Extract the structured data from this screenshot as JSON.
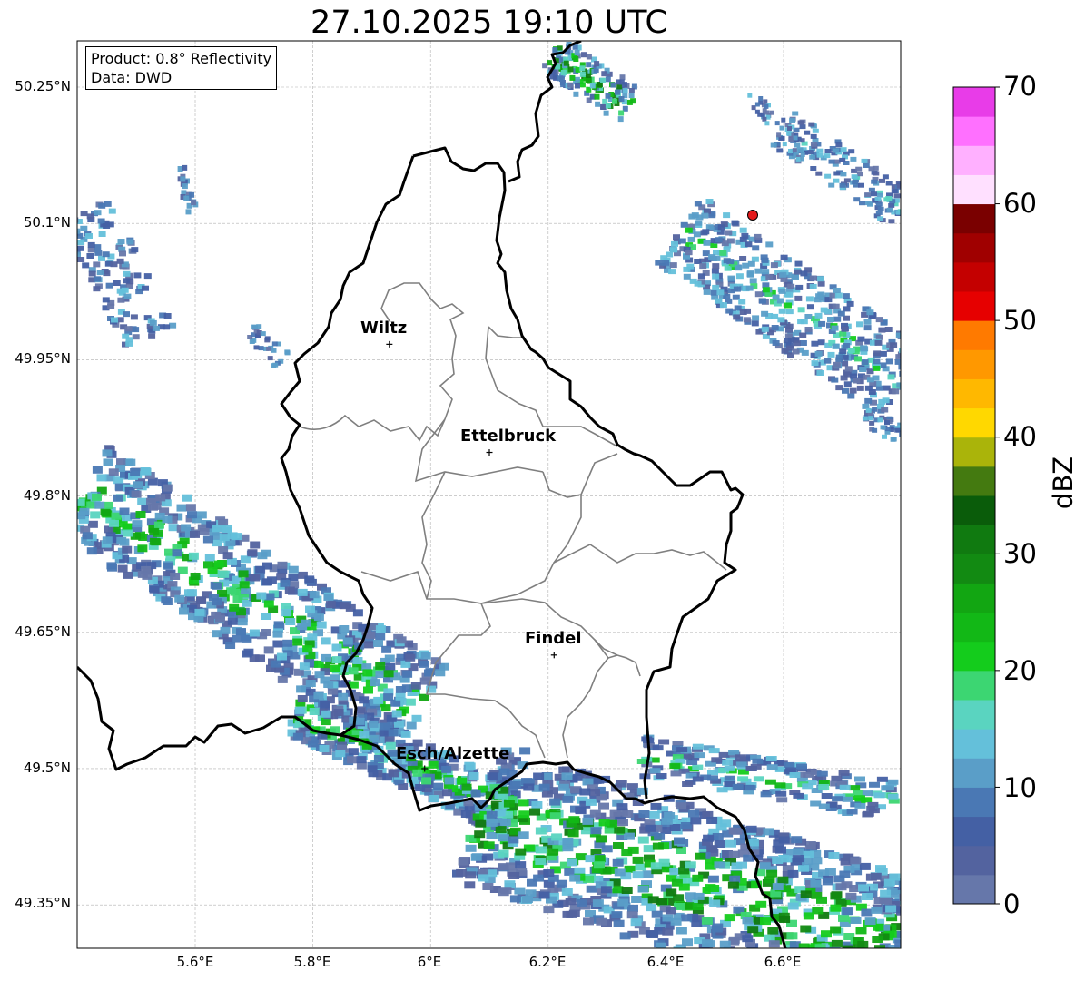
{
  "title": "27.10.2025 19:10 UTC",
  "info": {
    "product": "Product: 0.8° Reflectivity",
    "data": "Data: DWD"
  },
  "lon_labels": [
    "5.6°E",
    "5.8°E",
    "6°E",
    "6.2°E",
    "6.4°E",
    "6.6°E"
  ],
  "lat_labels": [
    "50.25°N",
    "50.1°N",
    "49.95°N",
    "49.8°N",
    "49.65°N",
    "49.5°N",
    "49.35°N"
  ],
  "cities": [
    {
      "name": "Wiltz",
      "lon": 5.93,
      "lat": 49.967
    },
    {
      "name": "Ettelbruck",
      "lon": 6.1,
      "lat": 49.848
    },
    {
      "name": "Findel",
      "lon": 6.21,
      "lat": 49.625
    },
    {
      "name": "Esch/Alzette",
      "lon": 5.99,
      "lat": 49.5
    }
  ],
  "radar_site_color": "#e31a1c",
  "colorbar": {
    "label": "dBZ",
    "ticks": [
      "0",
      "10",
      "20",
      "30",
      "40",
      "50",
      "60",
      "70"
    ],
    "min": 0,
    "max": 70,
    "colors": [
      "#6677aa",
      "#53639f",
      "#4460a4",
      "#4a78b4",
      "#5a9ec8",
      "#64c0da",
      "#5ad4c0",
      "#3cd672",
      "#14cc1c",
      "#12b816",
      "#12a612",
      "#128a12",
      "#107a10",
      "#0a5c0a",
      "#447a10",
      "#aab40a",
      "#ffd800",
      "#ffb800",
      "#ff9800",
      "#ff7a00",
      "#e60000",
      "#c40000",
      "#a00000",
      "#7a0000",
      "#ffe0ff",
      "#ffb0ff",
      "#ff70ff",
      "#e83ce8"
    ]
  },
  "grid": true
}
